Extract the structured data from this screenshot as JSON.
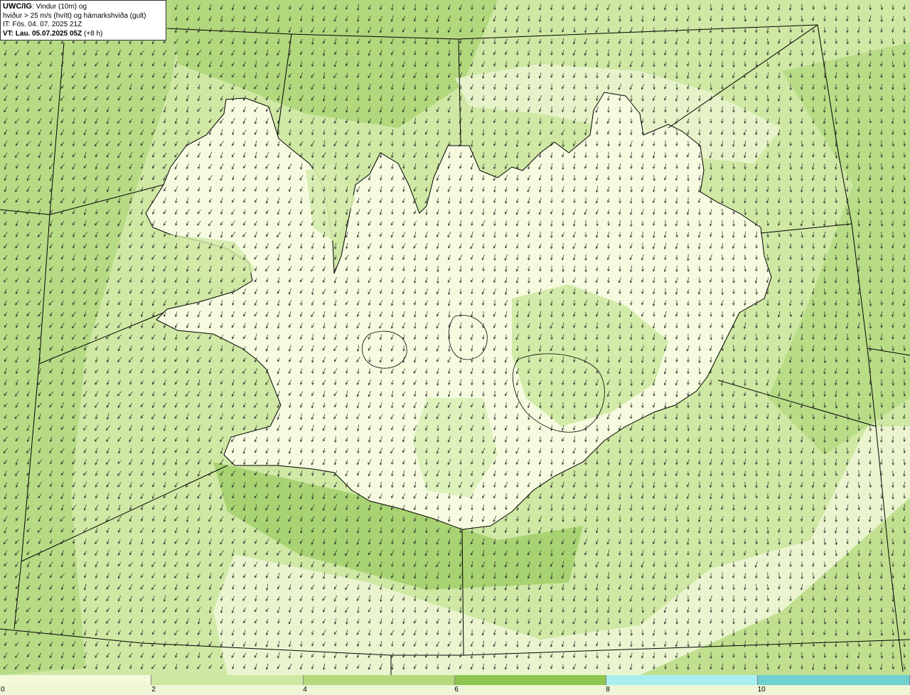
{
  "header": {
    "model": "UWC/IG",
    "line1_rest": ": Vindur (10m) og",
    "line2": "hviður > 25 m/s (hvítt) og hámarkshviða (gult)",
    "line3": "IT: Fös. 04. 07. 2025 21Z",
    "valid_time": "VT: Lau. 05.07.2025 05Z",
    "lead": " (+8 h)"
  },
  "legend": {
    "unit_colors": [
      "#f3f9d9",
      "#cde8a0",
      "#b5d97c",
      "#8fc550",
      "#a8f0f0",
      "#6fd0d0"
    ],
    "ticks": [
      "0",
      "2",
      "4",
      "6",
      "8",
      "10"
    ]
  },
  "map": {
    "base_color": "#eef6d6",
    "land_color": "#f6fbe0",
    "wind_low_color": "#d7edb0",
    "wind_mid_color": "#b9dc87",
    "wind_high_color": "#9fcd66",
    "coast_color": "#000000",
    "arrow_color": "#2b2b2b",
    "dominant_wind_direction": "north-northeast"
  }
}
